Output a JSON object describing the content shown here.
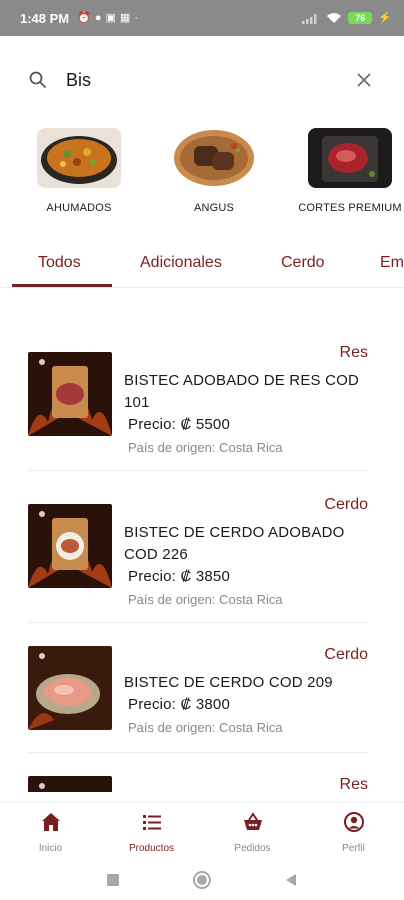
{
  "status_bar": {
    "time": "1:48 PM",
    "battery_level": "76"
  },
  "search": {
    "value": "Bis",
    "placeholder": ""
  },
  "categories": [
    {
      "label": "AHUMADOS",
      "image": "stew-bowl-image"
    },
    {
      "label": "ANGUS",
      "image": "grilled-steak-image"
    },
    {
      "label": "CORTES PREMIUM",
      "image": "raw-steak-image"
    }
  ],
  "tabs": [
    {
      "label": "Todos",
      "active": true
    },
    {
      "label": "Adicionales",
      "active": false
    },
    {
      "label": "Cerdo",
      "active": false
    },
    {
      "label": "Em",
      "active": false
    }
  ],
  "products": [
    {
      "category": "Res",
      "name": "BISTEC ADOBADO DE RES COD 101",
      "price": "Precio: ₡ 5500",
      "origin": "País de origen: Costa Rica"
    },
    {
      "category": "Cerdo",
      "name": "BISTEC DE CERDO ADOBADO COD 226",
      "price": "Precio: ₡ 3850",
      "origin": "País de origen: Costa Rica"
    },
    {
      "category": "Cerdo",
      "name": "BISTEC DE CERDO COD 209",
      "price": "Precio: ₡ 3800",
      "origin": "País de origen: Costa Rica"
    },
    {
      "category": "Res",
      "name": "",
      "price": "",
      "origin": ""
    }
  ],
  "bottom_nav": [
    {
      "label": "Inicio",
      "icon": "home-icon",
      "active": false
    },
    {
      "label": "Productos",
      "icon": "list-icon",
      "active": true
    },
    {
      "label": "Pedidos",
      "icon": "basket-icon",
      "active": false
    },
    {
      "label": "Perfil",
      "icon": "user-icon",
      "active": false
    }
  ],
  "colors": {
    "accent": "#7a1f1f",
    "muted": "#8a8a8a",
    "status_bar": "#8a8a8a"
  }
}
